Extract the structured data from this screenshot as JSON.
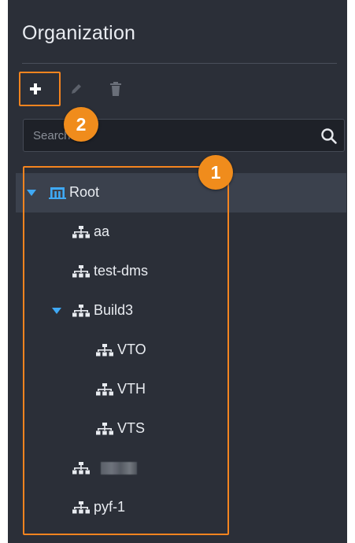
{
  "panel": {
    "title": "Organization"
  },
  "toolbar": {
    "add_icon": "plus-icon",
    "edit_icon": "pencil-icon",
    "delete_icon": "trash-icon"
  },
  "search": {
    "placeholder": "Search...",
    "value": "",
    "icon": "search-icon"
  },
  "tree": {
    "root": {
      "label": "Root",
      "expanded": true,
      "selected": true,
      "icon": "root-org-icon"
    },
    "nodes": [
      {
        "label": "aa",
        "depth": 1,
        "icon": "org-node-icon"
      },
      {
        "label": "test-dms",
        "depth": 1,
        "icon": "org-node-icon"
      },
      {
        "label": "Build3",
        "depth": 1,
        "expanded": true,
        "icon": "org-node-icon"
      },
      {
        "label": "VTO",
        "depth": 2,
        "icon": "org-node-icon"
      },
      {
        "label": "VTH",
        "depth": 2,
        "icon": "org-node-icon"
      },
      {
        "label": "VTS",
        "depth": 2,
        "icon": "org-node-icon"
      },
      {
        "label": "",
        "depth": 1,
        "icon": "org-node-icon",
        "redacted": true
      },
      {
        "label": "pyf-1",
        "depth": 1,
        "icon": "org-node-icon"
      }
    ]
  },
  "callouts": {
    "one": "1",
    "two": "2"
  },
  "colors": {
    "panel_bg": "#2b2f38",
    "selected_row": "#3b414d",
    "accent_blue": "#3fa9f5",
    "highlight_orange": "#f5841f",
    "callout_orange": "#f08c1c"
  }
}
